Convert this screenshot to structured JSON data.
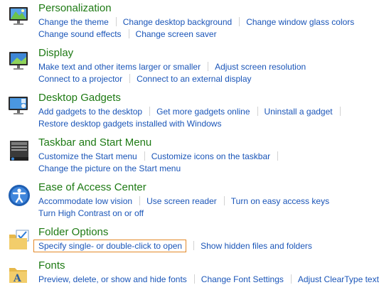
{
  "categories": [
    {
      "title": "Personalization",
      "icon": "personalization-monitor-icon",
      "line1": [
        "Change the theme",
        "Change desktop background",
        "Change window glass colors"
      ],
      "line2": [
        "Change sound effects",
        "Change screen saver"
      ]
    },
    {
      "title": "Display",
      "icon": "display-monitor-icon",
      "line1": [
        "Make text and other items larger or smaller",
        "Adjust screen resolution"
      ],
      "line2": [
        "Connect to a projector",
        "Connect to an external display"
      ]
    },
    {
      "title": "Desktop Gadgets",
      "icon": "desktop-gadgets-icon",
      "line1": [
        "Add gadgets to the desktop",
        "Get more gadgets online",
        "Uninstall a gadget"
      ],
      "line2": [
        "Restore desktop gadgets installed with Windows"
      ]
    },
    {
      "title": "Taskbar and Start Menu",
      "icon": "taskbar-start-menu-icon",
      "line1": [
        "Customize the Start menu",
        "Customize icons on the taskbar"
      ],
      "line2": [
        "Change the picture on the Start menu"
      ]
    },
    {
      "title": "Ease of Access Center",
      "icon": "ease-of-access-icon",
      "line1": [
        "Accommodate low vision",
        "Use screen reader",
        "Turn on easy access keys"
      ],
      "line2": [
        "Turn High Contrast on or off"
      ]
    },
    {
      "title": "Folder Options",
      "icon": "folder-options-icon",
      "line1": [
        "Specify single- or double-click to open",
        "Show hidden files and folders"
      ]
    },
    {
      "title": "Fonts",
      "icon": "fonts-folder-icon",
      "line1": [
        "Preview, delete, or show and hide fonts",
        "Change Font Settings",
        "Adjust ClearType text"
      ]
    }
  ],
  "colors": {
    "title": "#1e7a14",
    "link": "#1a55b8",
    "separator": "#d2d2d2",
    "focus_border": "#e3892a"
  }
}
